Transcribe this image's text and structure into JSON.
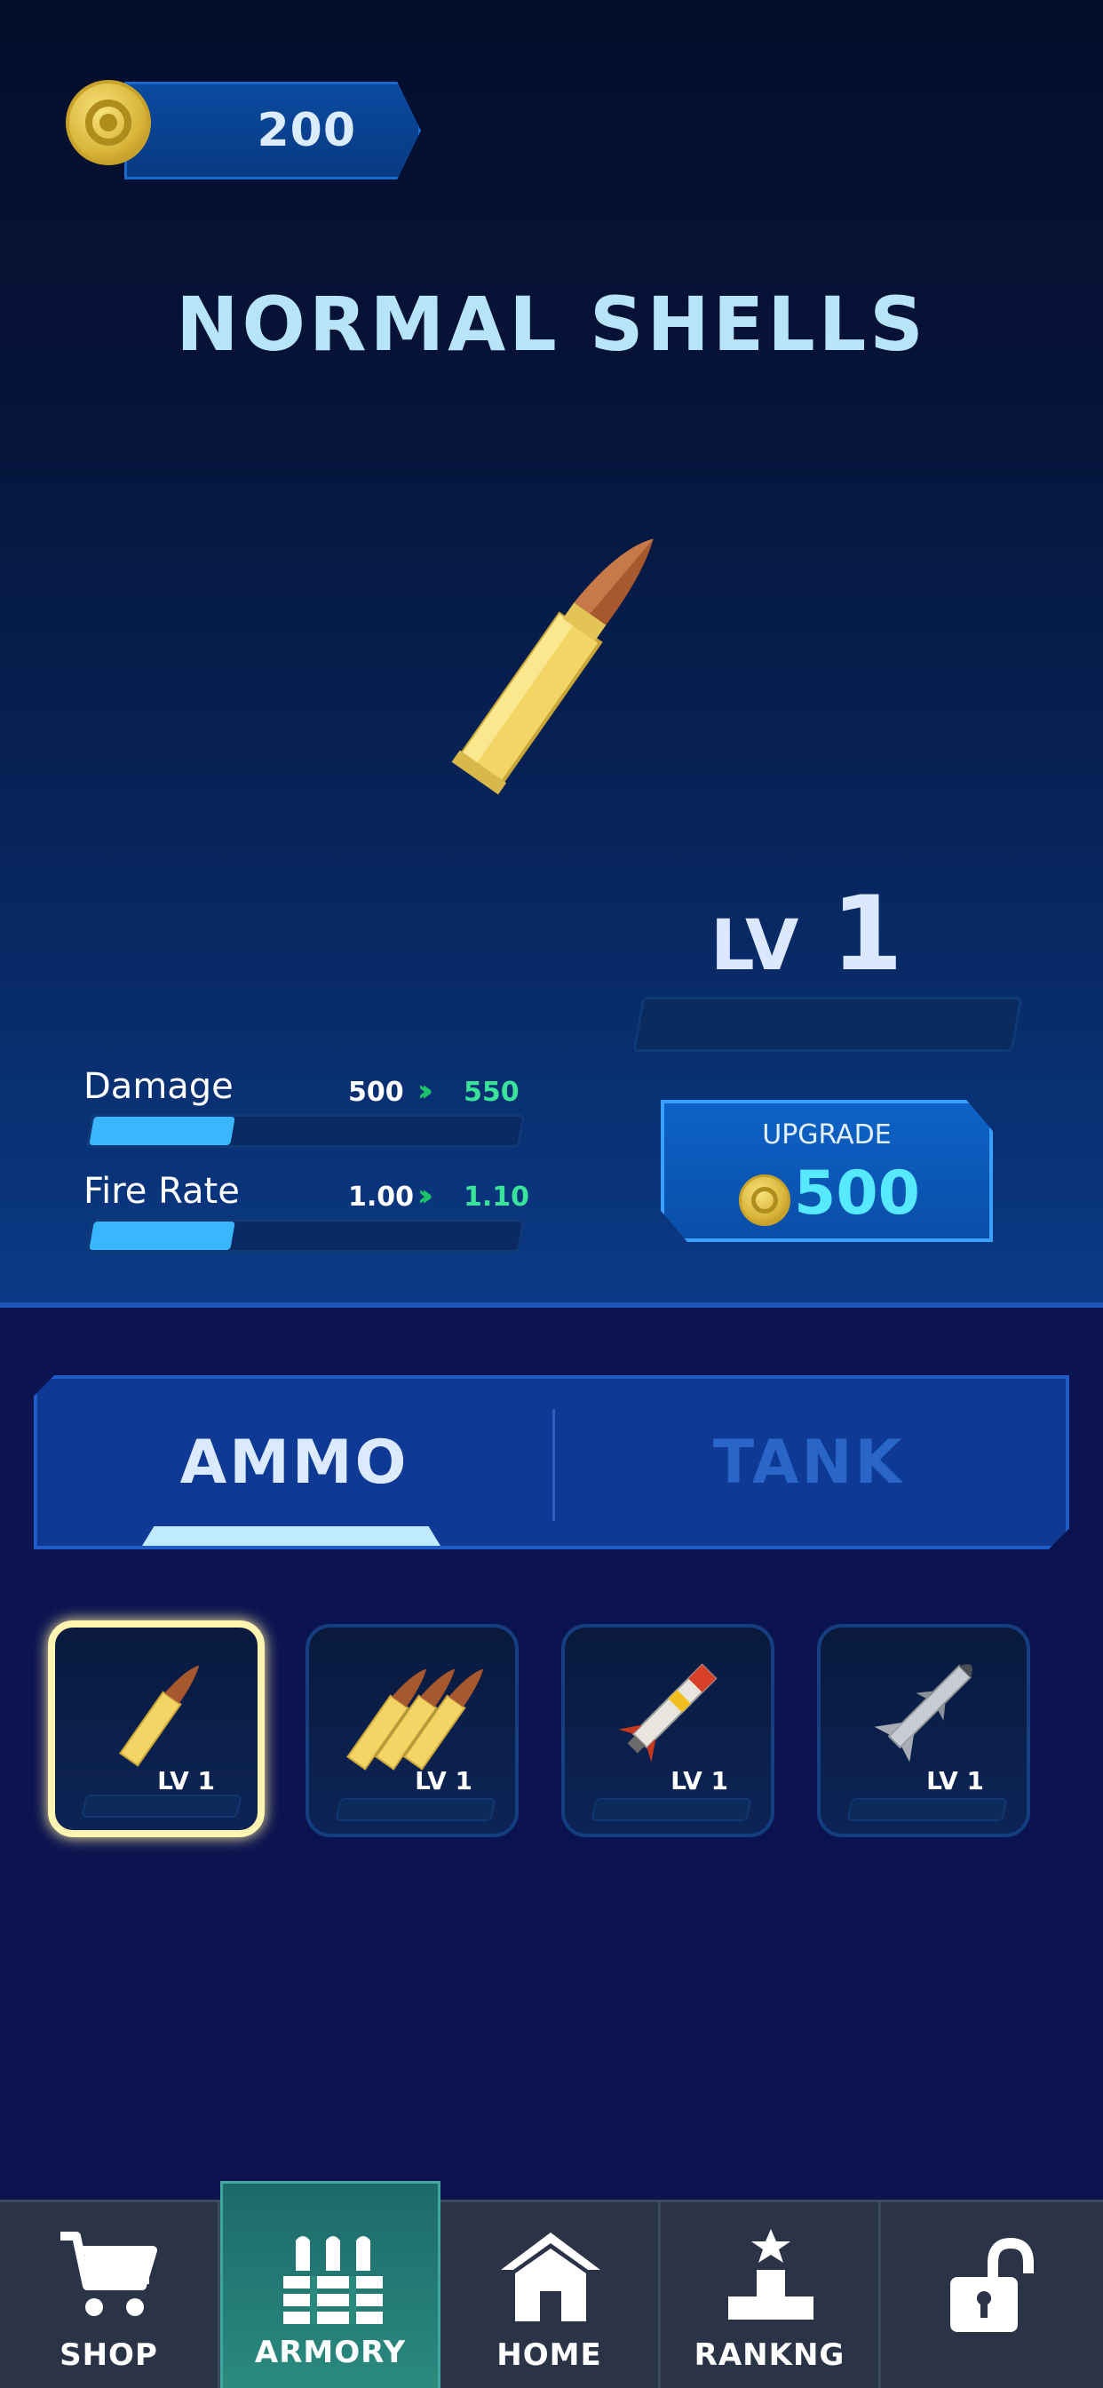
{
  "currency": {
    "coins": "200"
  },
  "item": {
    "title": "NORMAL SHELLS",
    "level_label": "LV",
    "level_value": "1"
  },
  "stats": [
    {
      "name": "Damage",
      "current": "500",
      "next": "550",
      "fill_fraction": 0.33
    },
    {
      "name": "Fire Rate",
      "current": "1.00",
      "next": "1.10",
      "fill_fraction": 0.33
    }
  ],
  "upgrade": {
    "label": "UPGRADE",
    "price": "500"
  },
  "tabs": [
    {
      "label": "AMMO",
      "active": true
    },
    {
      "label": "TANK",
      "active": false
    }
  ],
  "ammo_cards": [
    {
      "icon": "single-bullet-icon",
      "level": "LV 1",
      "selected": true
    },
    {
      "icon": "triple-bullets-icon",
      "level": "LV 1",
      "selected": false
    },
    {
      "icon": "rocket-icon",
      "level": "LV 1",
      "selected": false
    },
    {
      "icon": "missile-icon",
      "level": "LV 1",
      "selected": false
    }
  ],
  "nav": [
    {
      "label": "SHOP",
      "icon": "cart-icon",
      "active": false
    },
    {
      "label": "ARMORY",
      "icon": "ammo-rack-icon",
      "active": true
    },
    {
      "label": "HOME",
      "icon": "home-icon",
      "active": false
    },
    {
      "label": "RANKNG",
      "icon": "podium-icon",
      "active": false
    },
    {
      "label": "",
      "icon": "unlock-icon",
      "active": false
    }
  ],
  "colors": {
    "accent": "#57e9ff",
    "stat_fill": "#3ab6ff",
    "stat_next": "#39e39a",
    "coin_gold": "#d9b53a",
    "armory_active": "#2b8a7e"
  }
}
